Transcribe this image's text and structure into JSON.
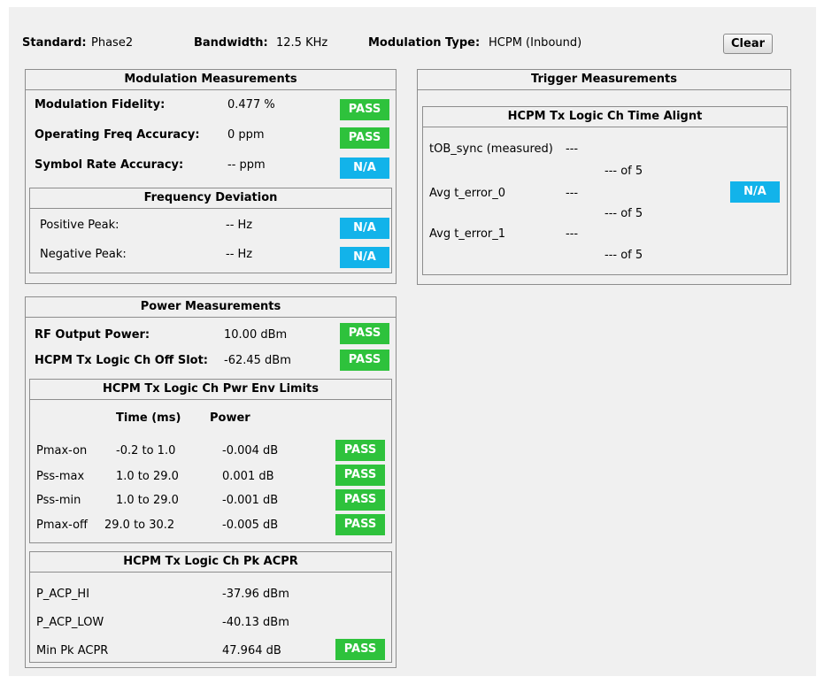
{
  "header": {
    "standard_label": "Standard:",
    "standard_value": "Phase2",
    "bandwidth_label": "Bandwidth:",
    "bandwidth_value": "12.5 KHz",
    "modulation_label": "Modulation Type:",
    "modulation_value": "HCPM (Inbound)",
    "clear_label": "Clear"
  },
  "modulation": {
    "title": "Modulation Measurements",
    "rows": [
      {
        "label": "Modulation Fidelity:",
        "value": "0.477 %",
        "status": "PASS"
      },
      {
        "label": "Operating Freq Accuracy:",
        "value": "0 ppm",
        "status": "PASS"
      },
      {
        "label": "Symbol Rate Accuracy:",
        "value": "-- ppm",
        "status": "N/A"
      }
    ],
    "freq_dev": {
      "title": "Frequency Deviation",
      "rows": [
        {
          "label": "Positive Peak:",
          "value": "-- Hz",
          "status": "N/A"
        },
        {
          "label": "Negative Peak:",
          "value": "-- Hz",
          "status": "N/A"
        }
      ]
    }
  },
  "trigger": {
    "title": "Trigger Measurements",
    "align": {
      "title": "HCPM Tx Logic Ch Time Alignt",
      "rows": [
        {
          "label": "tOB_sync (measured)",
          "value": "---",
          "count": "--- of 5"
        },
        {
          "label": "Avg t_error_0",
          "value": "---",
          "count": "--- of 5"
        },
        {
          "label": "Avg t_error_1",
          "value": "---",
          "count": "--- of 5"
        }
      ],
      "status": "N/A"
    }
  },
  "power": {
    "title": "Power Measurements",
    "rows": [
      {
        "label": "RF Output Power:",
        "value": "10.00 dBm",
        "status": "PASS"
      },
      {
        "label": "HCPM Tx Logic Ch Off Slot:",
        "value": "-62.45 dBm",
        "status": "PASS"
      }
    ],
    "env": {
      "title": "HCPM Tx Logic Ch Pwr Env Limits",
      "col_time": "Time (ms)",
      "col_power": "Power",
      "rows": [
        {
          "name": "Pmax-on",
          "time": "-0.2 to 1.0",
          "power": "-0.004 dB",
          "status": "PASS"
        },
        {
          "name": "Pss-max",
          "time": "1.0 to 29.0",
          "power": "0.001 dB",
          "status": "PASS"
        },
        {
          "name": "Pss-min",
          "time": "1.0 to 29.0",
          "power": "-0.001 dB",
          "status": "PASS"
        },
        {
          "name": "Pmax-off",
          "time": "29.0 to 30.2",
          "power": "-0.005 dB",
          "status": "PASS"
        }
      ]
    },
    "acpr": {
      "title": "HCPM Tx Logic Ch Pk ACPR",
      "rows": [
        {
          "label": "P_ACP_HI",
          "value": "-37.96 dBm"
        },
        {
          "label": "P_ACP_LOW",
          "value": "-40.13 dBm"
        },
        {
          "label": "Min Pk ACPR",
          "value": "47.964 dB",
          "status": "PASS"
        }
      ]
    }
  },
  "colors": {
    "pass": "#2ec23c",
    "na": "#12b3ea",
    "panel_bg": "#f0f0f0",
    "border": "#8d8d8d"
  }
}
